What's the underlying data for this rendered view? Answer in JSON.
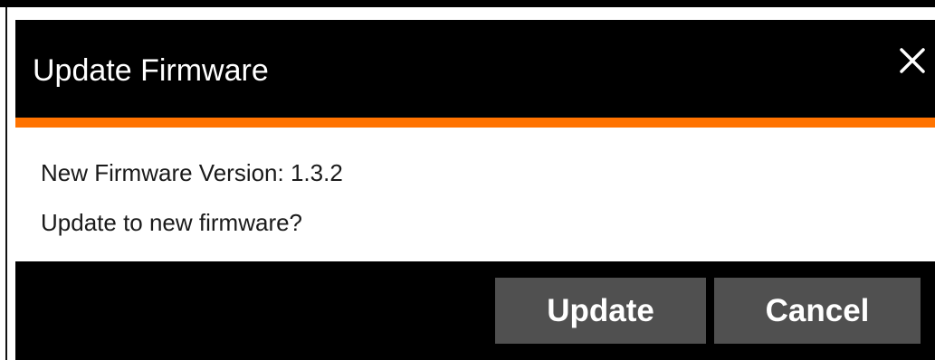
{
  "dialog": {
    "title": "Update Firmware",
    "close_icon": "close-icon",
    "message": {
      "version_line": "New Firmware Version: 1.3.2",
      "question": "Update to new firmware?"
    },
    "buttons": {
      "update_label": "Update",
      "cancel_label": "Cancel"
    }
  },
  "colors": {
    "header_bg": "#000000",
    "accent": "#ff7300",
    "button_bg": "#505050",
    "button_text": "#ffffff",
    "body_text": "#1a1a1a"
  }
}
